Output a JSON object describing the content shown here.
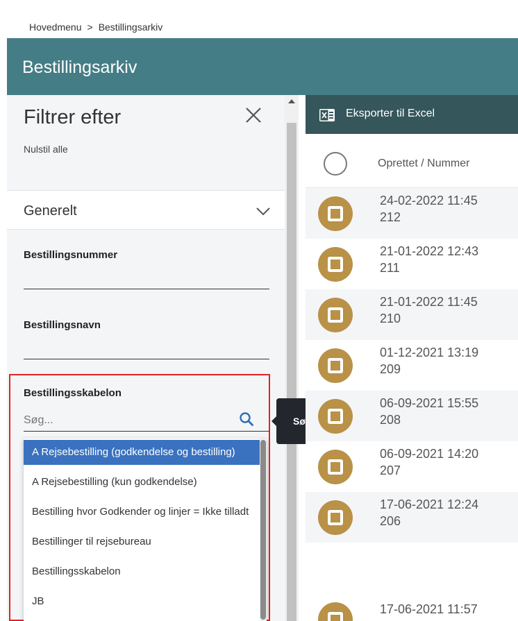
{
  "breadcrumb": {
    "items": [
      "Hovedmenu",
      "Bestillingsarkiv"
    ],
    "separator": ">"
  },
  "header": {
    "title": "Bestillingsarkiv"
  },
  "filter": {
    "title": "Filtrer efter",
    "reset": "Nulstil alle",
    "section": "Generelt",
    "fields": [
      {
        "label": "Bestillingsnummer",
        "value": ""
      },
      {
        "label": "Bestillingsnavn",
        "value": ""
      }
    ],
    "template": {
      "label": "Bestillingsskabelon",
      "placeholder": "Søg...",
      "options": [
        "A Rejsebestilling (godkendelse og bestilling)",
        "A Rejsebestilling (kun godkendelse)",
        "Bestilling hvor Godkender og linjer = Ikke tilladt",
        "Bestillinger til rejsebureau",
        "Bestillingsskabelon",
        "JB"
      ],
      "selected_index": 0
    }
  },
  "tooltip": {
    "text": "Søg"
  },
  "list": {
    "export_label": "Eksporter til Excel",
    "column_header": "Oprettet / Nummer",
    "rows": [
      {
        "date": "24-02-2022 11:45",
        "number": "212"
      },
      {
        "date": "21-01-2022 12:43",
        "number": "211"
      },
      {
        "date": "21-01-2022 11:45",
        "number": "210"
      },
      {
        "date": "01-12-2021 13:19",
        "number": "209"
      },
      {
        "date": "06-09-2021 15:55",
        "number": "208"
      },
      {
        "date": "06-09-2021 14:20",
        "number": "207"
      },
      {
        "date": "17-06-2021 12:24",
        "number": "206"
      },
      {
        "date": "17-06-2021 11:57",
        "number": ""
      }
    ]
  },
  "colors": {
    "header": "#457d86",
    "toolbar": "#35565b",
    "badge": "#b99147",
    "selected_option": "#3a72c0",
    "highlight_border": "#e02424"
  }
}
